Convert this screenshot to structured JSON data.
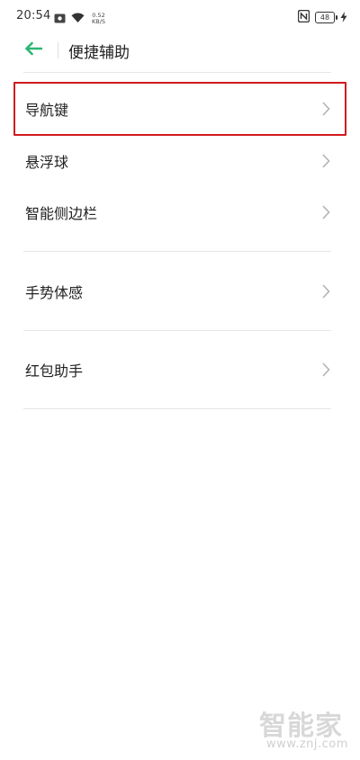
{
  "status_bar": {
    "time": "20:54",
    "net_speed_value": "0.52",
    "net_speed_unit": "KB/S",
    "battery_level": "48",
    "icons": [
      "photo-icon",
      "wifi-icon",
      "nfc-icon",
      "battery-icon",
      "charging-icon"
    ]
  },
  "header": {
    "title": "便捷辅助",
    "back_icon": "back-arrow-icon",
    "accent_color": "#2bb673"
  },
  "list": {
    "items": [
      {
        "label": "导航键",
        "highlighted": true
      },
      {
        "label": "悬浮球",
        "highlighted": false
      },
      {
        "label": "智能侧边栏",
        "highlighted": false
      },
      {
        "label": "手势体感",
        "highlighted": false
      },
      {
        "label": "红包助手",
        "highlighted": false
      }
    ],
    "chevron_icon": "chevron-right-icon",
    "highlight_color": "#d11a1a"
  },
  "watermark": {
    "text": "智能家",
    "url": "www.znj.com"
  }
}
